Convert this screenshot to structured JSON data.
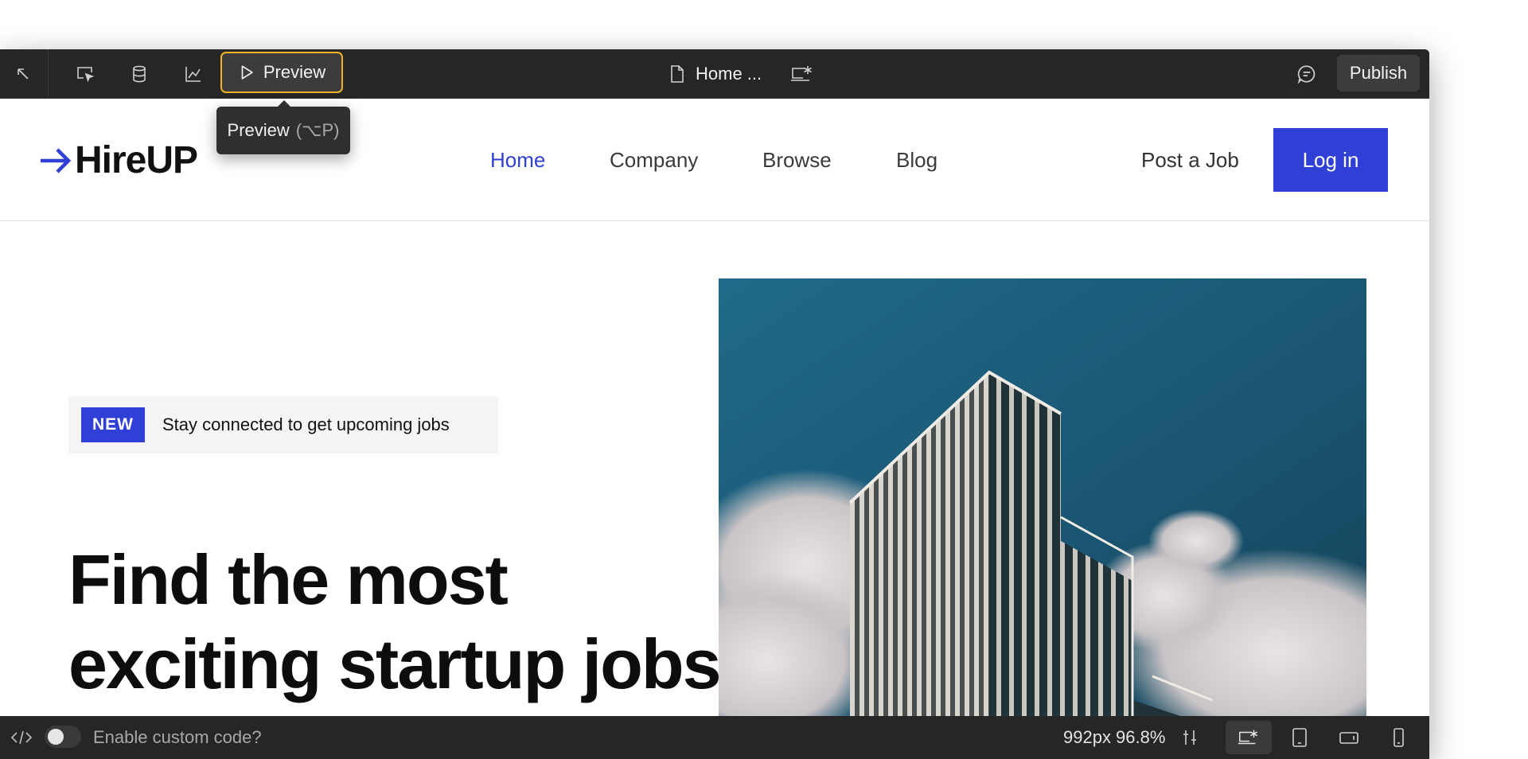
{
  "toolbar": {
    "preview_label": "Preview",
    "page_name": "Home ...",
    "publish_label": "Publish",
    "icons": [
      "pointer-icon",
      "select-icon",
      "database-icon",
      "analytics-icon",
      "play-icon",
      "page-icon",
      "breakpoint-desktop-icon",
      "comment-icon"
    ]
  },
  "tooltip": {
    "label": "Preview",
    "shortcut": "(⌥P)"
  },
  "site": {
    "logo_text": "HireUP",
    "nav": {
      "home": "Home",
      "company": "Company",
      "browse": "Browse",
      "blog": "Blog"
    },
    "post_job": "Post a Job",
    "login": "Log in",
    "badge": "NEW",
    "badge_text": "Stay connected to get upcoming jobs",
    "headline_line1": "Find the most",
    "headline_line2": "exciting startup jobs",
    "accent_color": "#3040d6"
  },
  "bottombar": {
    "custom_code_label": "Enable custom code?",
    "dimensions": "992px 96.8%"
  }
}
